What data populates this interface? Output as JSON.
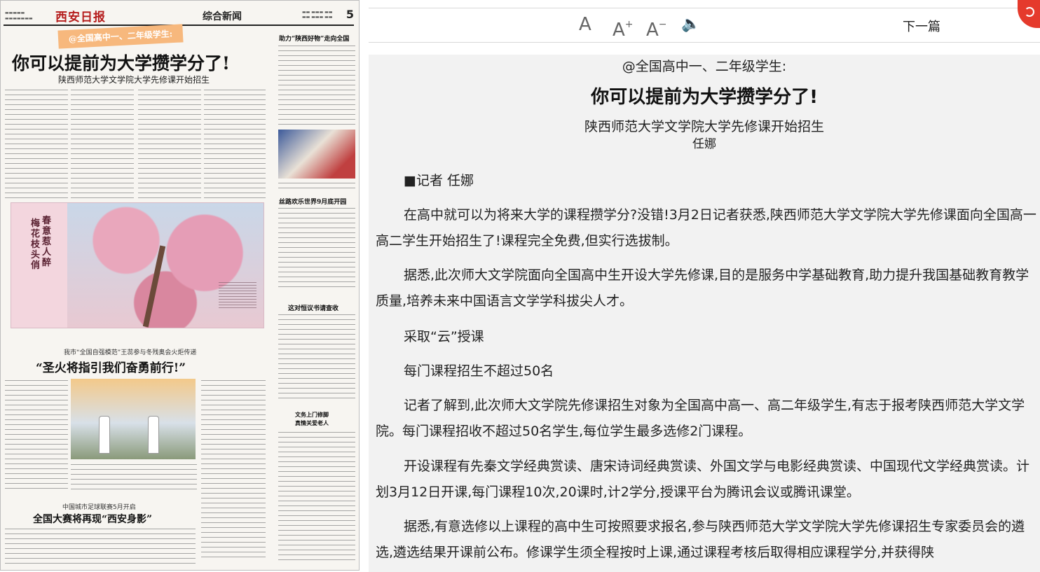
{
  "newspaper": {
    "masthead_logo": "西安日报",
    "section": "综合新闻",
    "page_no": "5",
    "ribbon": "@全国高中一、二年级学生:",
    "headline": "你可以提前为大学攒学分了!",
    "subhead": "陕西师范大学文学院大学先修课开始招生",
    "right_col_head_1": "助力“陕西好物”走向全国",
    "right_col_head_2": "丝路欢乐世界9月底开园",
    "right_col_head_3": "这对恒议书请查收",
    "photo_caption_vertical_1": "春意惹人醉",
    "photo_caption_vertical_2": "梅花枝头俏",
    "torch_kicker": "我市“全国自强模范”王蕊参与冬残奥会火炬传递",
    "torch_headline": "“圣火将指引我们奋勇前行!”",
    "football_kicker": "中国城市足球联赛5月开启",
    "football_headline": "全国大赛将再现“西安身影”",
    "small_head_1": "文务上门修脚",
    "small_head_2": "真情关爱老人"
  },
  "toolbar": {
    "font_a": "A",
    "font_plus": "A",
    "font_plus_sup": "+",
    "font_minus": "A",
    "font_minus_sup": "−",
    "speaker": "🔈",
    "next_label": "下一篇"
  },
  "article": {
    "kicker": "@全国高中一、二年级学生:",
    "title": "你可以提前为大学攒学分了!",
    "subtitle": "陕西师范大学文学院大学先修课开始招生",
    "author_name": "任娜",
    "paragraphs": [
      "■记者 任娜",
      "在高中就可以为将来大学的课程攒学分?没错!3月2日记者获悉,陕西师范大学文学院大学先修课面向全国高一高二学生开始招生了!课程完全免费,但实行选拔制。",
      "据悉,此次师大文学院面向全国高中生开设大学先修课,目的是服务中学基础教育,助力提升我国基础教育教学质量,培养未来中国语言文学学科拔尖人才。",
      "采取“云”授课",
      "每门课程招生不超过50名",
      "记者了解到,此次师大文学院先修课招生对象为全国高中高一、高二年级学生,有志于报考陕西师范大学文学院。每门课程招收不超过50名学生,每位学生最多选修2门课程。",
      "开设课程有先秦文学经典赏读、唐宋诗词经典赏读、外国文学与电影经典赏读、中国现代文学经典赏读。计划3月12日开课,每门课程10次,20课时,计2学分,授课平台为腾讯会议或腾讯课堂。",
      "据悉,有意选修以上课程的高中生可按照要求报名,参与陕西师范大学文学院大学先修课招生专家委员会的遴选,遴选结果开课前公布。修课学生须全程按时上课,通过课程考核后取得相应课程学分,并获得陕"
    ]
  }
}
